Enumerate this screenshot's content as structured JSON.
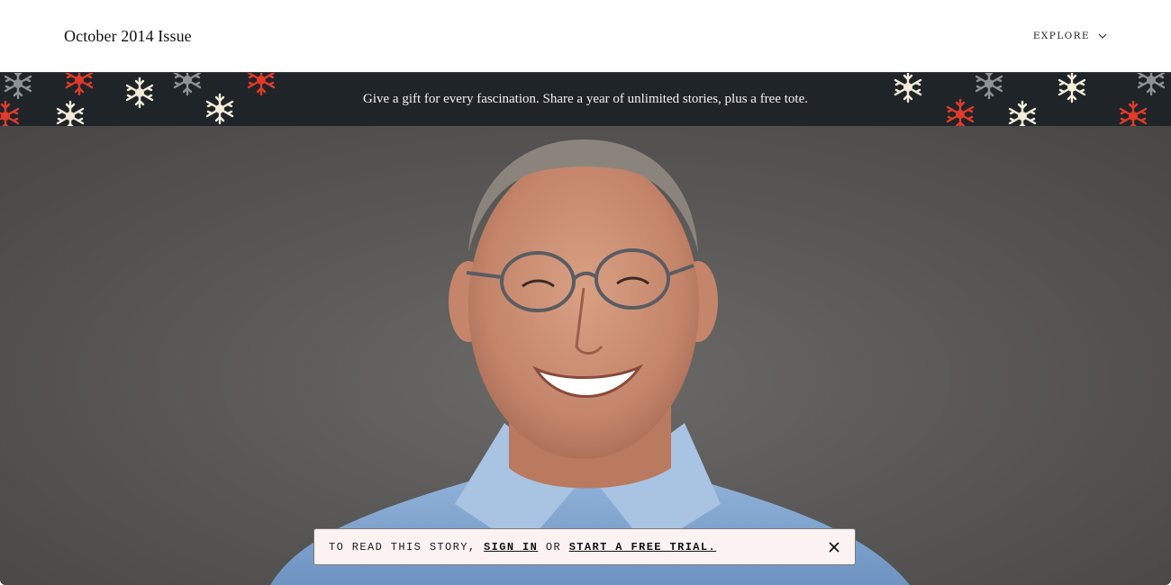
{
  "header": {
    "issue_title": "October 2014 Issue",
    "explore_label": "EXPLORE",
    "explore_icon": "chevron-down-icon"
  },
  "promo": {
    "text": "Give a gift for every fascination. Share a year of unlimited stories, plus a free tote.",
    "colors": {
      "background": "#1f2428",
      "flake_red": "#e03a2a",
      "flake_cream": "#f3ecd8",
      "flake_gray": "#8d9296"
    }
  },
  "hero": {
    "description_icon": "portrait-photo"
  },
  "paywall": {
    "prefix": "TO READ THIS STORY,",
    "sign_in": "SIGN IN",
    "middle": "OR",
    "trial": "START A FREE TRIAL.",
    "close_icon": "close-icon",
    "colors": {
      "background": "#fcf2f2",
      "border": "#7c7c7c"
    }
  }
}
